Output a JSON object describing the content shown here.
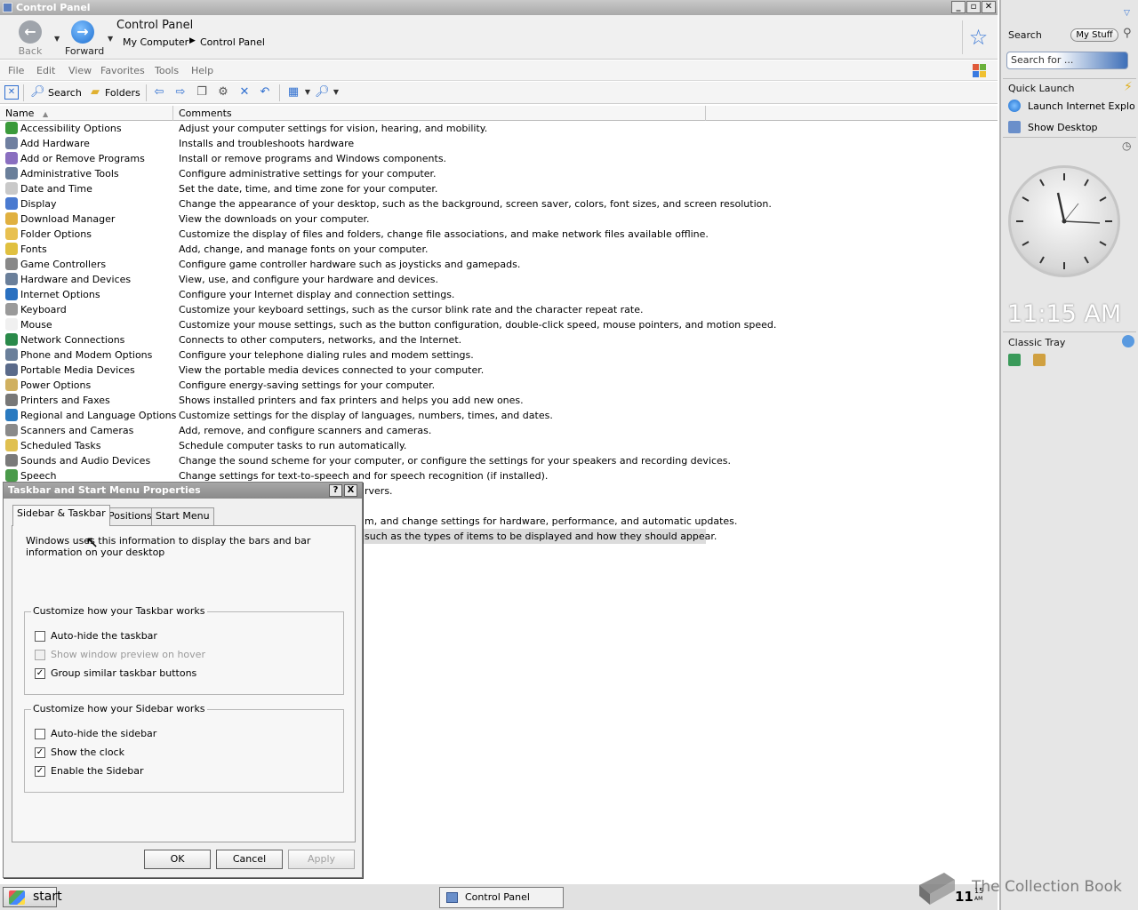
{
  "window": {
    "title": "Control Panel",
    "nav": {
      "back": "Back",
      "forward": "Forward"
    },
    "address": {
      "title": "Control Panel",
      "crumbs": [
        "My Computer",
        "Control Panel"
      ]
    },
    "menu": [
      "File",
      "Edit",
      "View",
      "Favorites",
      "Tools",
      "Help"
    ],
    "toolbar": {
      "search": "Search",
      "folders": "Folders"
    },
    "columns": {
      "name": "Name",
      "comments": "Comments"
    },
    "items": [
      {
        "name": "Accessibility Options",
        "comment": "Adjust your computer settings for vision, hearing, and mobility."
      },
      {
        "name": "Add Hardware",
        "comment": "Installs and troubleshoots hardware"
      },
      {
        "name": "Add or Remove Programs",
        "comment": "Install or remove programs and Windows components."
      },
      {
        "name": "Administrative Tools",
        "comment": "Configure administrative settings for your computer."
      },
      {
        "name": "Date and Time",
        "comment": "Set the date, time, and time zone for your computer."
      },
      {
        "name": "Display",
        "comment": "Change the appearance of your desktop, such as the background, screen saver, colors, font sizes, and screen resolution."
      },
      {
        "name": "Download Manager",
        "comment": "View the downloads on your computer."
      },
      {
        "name": "Folder Options",
        "comment": "Customize the display of files and folders, change file associations, and make network files available offline."
      },
      {
        "name": "Fonts",
        "comment": "Add, change, and manage fonts on your computer."
      },
      {
        "name": "Game Controllers",
        "comment": "Configure game controller hardware such as joysticks and gamepads."
      },
      {
        "name": "Hardware and Devices",
        "comment": "View, use, and configure your hardware and devices."
      },
      {
        "name": "Internet Options",
        "comment": "Configure your Internet display and connection settings."
      },
      {
        "name": "Keyboard",
        "comment": "Customize your keyboard settings, such as the cursor blink rate and the character repeat rate."
      },
      {
        "name": "Mouse",
        "comment": "Customize your mouse settings, such as the button configuration, double-click speed, mouse pointers, and motion speed."
      },
      {
        "name": "Network Connections",
        "comment": "Connects to other computers, networks, and the Internet."
      },
      {
        "name": "Phone and Modem Options",
        "comment": "Configure your telephone dialing rules and modem settings."
      },
      {
        "name": "Portable Media Devices",
        "comment": "View the portable media devices connected to your computer."
      },
      {
        "name": "Power Options",
        "comment": "Configure energy-saving settings for your computer."
      },
      {
        "name": "Printers and Faxes",
        "comment": "Shows installed printers and fax printers and helps you add new ones."
      },
      {
        "name": "Regional and Language Options",
        "comment": "Customize settings for the display of languages, numbers, times, and dates."
      },
      {
        "name": "Scanners and Cameras",
        "comment": "Add, remove, and configure scanners and cameras."
      },
      {
        "name": "Scheduled Tasks",
        "comment": "Schedule computer tasks to run automatically."
      },
      {
        "name": "Sounds and Audio Devices",
        "comment": "Change the sound scheme for your computer, or configure the settings for your speakers and recording devices."
      },
      {
        "name": "Speech",
        "comment": "Change settings for text-to-speech and for speech recognition (if installed)."
      },
      {
        "name": "",
        "comment": "rvers."
      },
      {
        "name": "",
        "comment": ""
      },
      {
        "name": "",
        "comment": "m, and change settings for hardware, performance, and automatic updates."
      },
      {
        "name": "",
        "comment": "such as the types of items to be displayed and how they should appear."
      }
    ],
    "icon_colors": [
      "#3a9a3a",
      "#6f7fa0",
      "#8a6fc0",
      "#6a7f9a",
      "#c9c9c9",
      "#4a7ad0",
      "#e0b040",
      "#e8c050",
      "#e0c040",
      "#888888",
      "#6a7f9a",
      "#2a70c0",
      "#9a9a9a",
      "#f0f0f0",
      "#2a8a4a",
      "#6a7f9a",
      "#5a6a8a",
      "#d0b060",
      "#777777",
      "#2a7ac0",
      "#8a8a8a",
      "#e0c050",
      "#7a7a7a",
      "#4a9a4a"
    ]
  },
  "sidebar": {
    "search_label": "Search",
    "mystuff": "My Stuff",
    "search_placeholder": "Search for ...",
    "quick_launch": "Quick Launch",
    "ql_items": [
      "Launch Internet Explorer Browser",
      "Show Desktop"
    ],
    "clock_time": "11:15 AM",
    "classic_tray": "Classic Tray"
  },
  "dialog": {
    "title": "Taskbar and Start Menu Properties",
    "help_btn": "?",
    "close_btn": "X",
    "tabs": [
      "Sidebar & Taskbar",
      "Positions",
      "Start Menu"
    ],
    "intro": "Windows uses this information to display the bars and bar information on your desktop",
    "taskbar_group": "Customize how your Taskbar works",
    "taskbar_opts": [
      {
        "label": "Auto-hide the taskbar",
        "checked": false,
        "disabled": false
      },
      {
        "label": "Show window preview on hover",
        "checked": false,
        "disabled": true
      },
      {
        "label": "Group similar taskbar buttons",
        "checked": true,
        "disabled": false
      }
    ],
    "sidebar_group": "Customize how your Sidebar works",
    "sidebar_opts": [
      {
        "label": "Auto-hide the sidebar",
        "checked": false,
        "disabled": false
      },
      {
        "label": "Show the clock",
        "checked": true,
        "disabled": false
      },
      {
        "label": "Enable the Sidebar",
        "checked": true,
        "disabled": false
      }
    ],
    "ok": "OK",
    "cancel": "Cancel",
    "apply": "Apply"
  },
  "taskbar": {
    "start": "start",
    "task": "Control Panel",
    "time": "11",
    "time_seconds": "15",
    "time_ampm": "AM"
  },
  "watermark": "The Collection Book"
}
